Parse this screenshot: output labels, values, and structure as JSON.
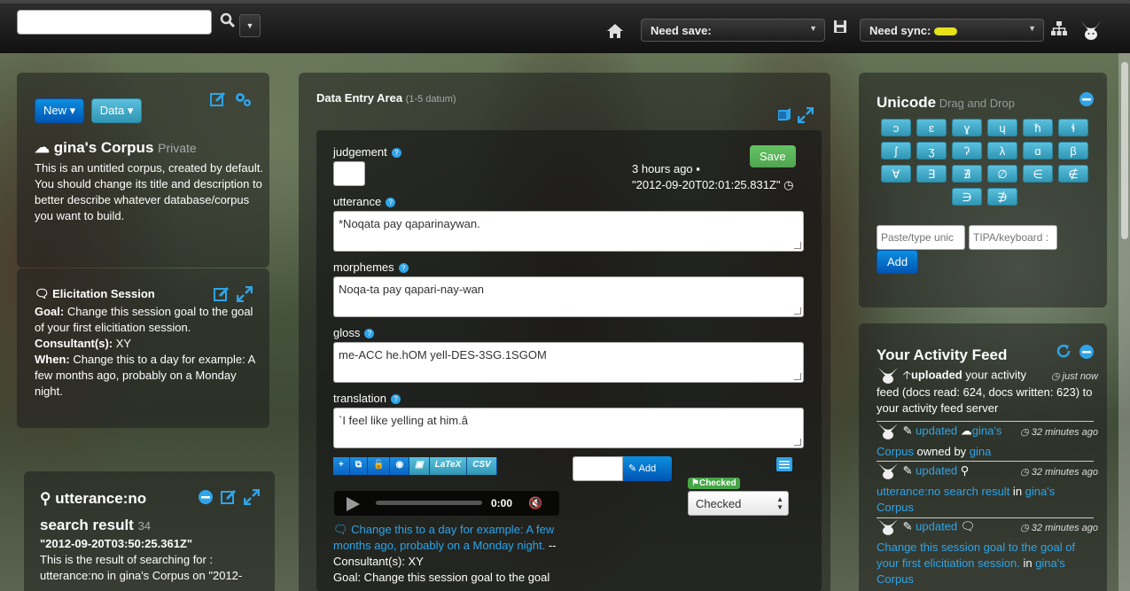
{
  "topbar": {
    "search_placeholder": "",
    "need_save_label": "Need save:",
    "need_sync_label": "Need sync:"
  },
  "corpus_panel": {
    "new_btn": "New",
    "data_btn": "Data",
    "title": "gina's Corpus",
    "privacy": "Private",
    "description": "This is an untitled corpus, created by default. You should change its title and description to better describe whatever database/corpus you want to build."
  },
  "session_panel": {
    "title": "Elicitation Session",
    "goal_label": "Goal:",
    "goal": "Change this session goal to the goal of your first elicitiation session.",
    "consultants_label": "Consultant(s):",
    "consultants": "XY",
    "when_label": "When:",
    "when": "Change this to a day for example: A few months ago, probably on a Monday night."
  },
  "search_panel": {
    "title1": "utterance:no",
    "title2": "search result",
    "count": "34",
    "date": "\"2012-09-20T03:50:25.361Z\"",
    "desc": "This is the result of searching for : utterance:no in gina's Corpus on \"2012-"
  },
  "data_entry": {
    "title": "Data Entry Area",
    "count": "(1-5 datum)",
    "judgement_label": "judgement",
    "save_btn": "Save",
    "time_ago": "3 hours ago",
    "timestamp": "\"2012-09-20T02:01:25.831Z\"",
    "utterance_label": "utterance",
    "utterance": "*Noqata pay qaparinaywan.",
    "morphemes_label": "morphemes",
    "morphemes": "Noqa-ta pay qapari-nay-wan",
    "gloss_label": "gloss",
    "gloss": "me-ACC he.hOM yell-DES-3SG.1SGOM",
    "translation_label": "translation",
    "translation": "`I feel like yelling at him.â",
    "tb_latex": "LaTeX",
    "tb_csv": "CSV",
    "add_btn": "Add",
    "checked_badge": "Checked",
    "checked_select": "Checked",
    "audio_time": "0:00",
    "session_link": "Change this to a day for example: A few months ago, probably on a Monday night.",
    "session_consultant": " -- Consultant(s): XY",
    "session_goal": "Goal: Change this session goal to the goal"
  },
  "unicode_panel": {
    "title": "Unicode",
    "subtitle": "Drag and Drop",
    "keys": [
      "ɔ",
      "ɛ",
      "ɣ",
      "ɥ",
      "ħ",
      "ɬ",
      "ʃ",
      "ʒ",
      "ʔ",
      "λ",
      "ɑ",
      "β",
      "∀",
      "∃",
      "∄",
      "∅",
      "∈",
      "∉",
      "∋",
      "∌"
    ],
    "paste_placeholder": "Paste/type unic",
    "tipa_placeholder": "TIPA/keyboard :",
    "add_btn": "Add"
  },
  "feed_panel": {
    "title": "Your Activity Feed",
    "item1": {
      "action": "uploaded",
      "text": " your activity",
      "time": "just now",
      "detail": "feed (docs read: 624, docs written: 623) to your activity feed server"
    },
    "item2": {
      "action": "updated",
      "target": "gina's",
      "target2": "Corpus",
      "owned": " owned by ",
      "owner": "gina",
      "time": "32 minutes ago"
    },
    "item3": {
      "action": "updated",
      "time": "32 minutes ago",
      "t1": "utterance:no search result",
      "in": " in ",
      "t2": "gina's",
      "t3": "Corpus"
    },
    "item4": {
      "action": "updated",
      "time": "32 minutes ago",
      "t1": "Change this session goal to the goal of your first elicitiation session.",
      "in": " in ",
      "t2": "gina's",
      "t3": "Corpus"
    }
  }
}
